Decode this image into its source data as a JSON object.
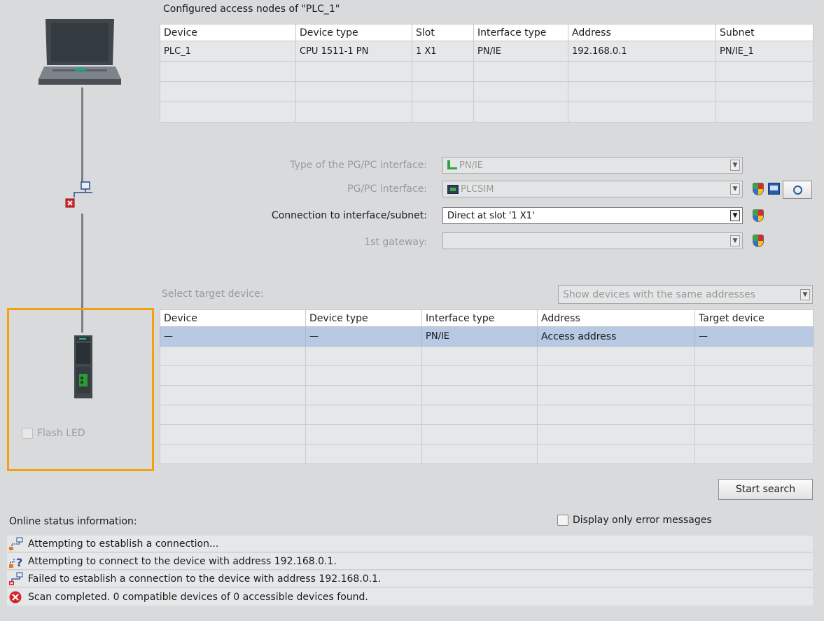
{
  "configured": {
    "title": "Configured access nodes of \"PLC_1\"",
    "columns": [
      "Device",
      "Device type",
      "Slot",
      "Interface type",
      "Address",
      "Subnet"
    ],
    "rows": [
      [
        "PLC_1",
        "CPU 1511-1 PN",
        "1 X1",
        "PN/IE",
        "192.168.0.1",
        "PN/IE_1"
      ],
      [
        "",
        "",
        "",
        "",
        "",
        ""
      ],
      [
        "",
        "",
        "",
        "",
        "",
        ""
      ],
      [
        "",
        "",
        "",
        "",
        "",
        ""
      ]
    ]
  },
  "settings": {
    "type_label": "Type of the PG/PC interface:",
    "type_value": "PN/IE",
    "pgpc_label": "PG/PC interface:",
    "pgpc_value": "PLCSIM",
    "conn_label": "Connection to interface/subnet:",
    "conn_value": "Direct at slot '1 X1'",
    "gateway_label": "1st gateway:",
    "gateway_value": ""
  },
  "target": {
    "label": "Select target device:",
    "filter_value": "Show devices with the same addresses",
    "columns": [
      "Device",
      "Device type",
      "Interface type",
      "Address",
      "Target device"
    ],
    "rows": [
      [
        "—",
        "—",
        "PN/IE",
        "Access address",
        "—"
      ],
      [
        "",
        "",
        "",
        "",
        ""
      ],
      [
        "",
        "",
        "",
        "",
        ""
      ],
      [
        "",
        "",
        "",
        "",
        ""
      ],
      [
        "",
        "",
        "",
        "",
        ""
      ],
      [
        "",
        "",
        "",
        "",
        ""
      ],
      [
        "",
        "",
        "",
        "",
        ""
      ]
    ]
  },
  "left_panel": {
    "flash_led_label": "Flash LED"
  },
  "buttons": {
    "start_search": "Start search"
  },
  "status": {
    "label": "Online status information:",
    "error_only_label": "Display only error messages",
    "messages": [
      {
        "icon": "connecting-icon",
        "text": "Attempting to establish a connection..."
      },
      {
        "icon": "connect-query-icon",
        "text": "Attempting to connect to the device with address 192.168.0.1."
      },
      {
        "icon": "connection-failed-icon",
        "text": "Failed to establish a connection to the device with address 192.168.0.1."
      },
      {
        "icon": "error-circle-icon",
        "text": "Scan completed. 0 compatible devices of 0 accessible devices found."
      }
    ]
  },
  "colors": {
    "background": "#d9dadc",
    "selected_row": "#b7c9e3",
    "highlight_frame": "#f5a012",
    "error_red": "#d4232b"
  }
}
